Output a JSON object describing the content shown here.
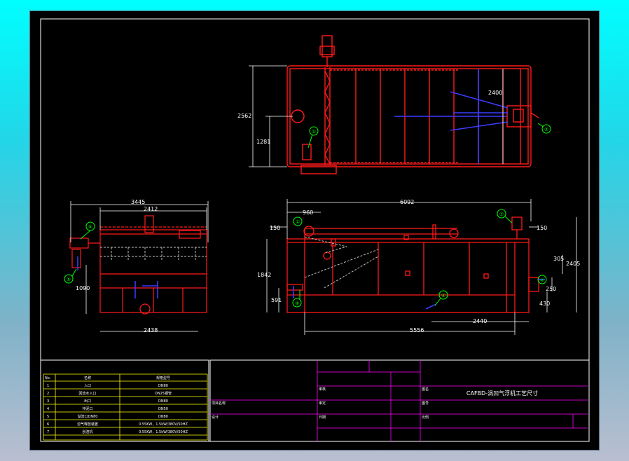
{
  "colors": {
    "background": "#000000",
    "frame": "#ffffff",
    "equipment": "#ff1a1a",
    "dimension": "#ffffff",
    "callout": "#00ff00",
    "pipe": "#3b3bff",
    "table_line": "#ffff00",
    "title_line": "#ff00ff",
    "screen_top": "#00ffff"
  },
  "plan_view": {
    "dims": {
      "length": "2562",
      "half": "1281",
      "inner": "2400"
    },
    "callouts": [
      "①",
      "②"
    ]
  },
  "side_view": {
    "dims": {
      "overall": "3445",
      "body": "2412",
      "base": "2438",
      "height": "1090"
    },
    "callouts": [
      "⑥",
      "⑤"
    ]
  },
  "front_view": {
    "dims": {
      "length": "6092",
      "inlet": "960",
      "left_offset": "150",
      "right_offset": "150",
      "height": "2405",
      "level": "1842",
      "outlet": "591",
      "d305": "305",
      "d250": "250",
      "d430": "430",
      "d2440": "2440",
      "base": "5556"
    },
    "callouts": [
      "①",
      "④",
      "③",
      "②",
      "⑦"
    ]
  },
  "parts_table": {
    "headers": [
      "No.",
      "名称",
      "规格型号"
    ],
    "rows": [
      [
        "1",
        "入口",
        "DN80"
      ],
      [
        "2",
        "回流水入口",
        "DN25钢管"
      ],
      [
        "3",
        "出口",
        "DN80"
      ],
      [
        "4",
        "排泥口",
        "DN50"
      ],
      [
        "5",
        "溢流口DN80",
        "DN80"
      ],
      [
        "6",
        "溶气释放装置",
        "0.55KW，1.5kW/380V/50HZ"
      ],
      [
        "7",
        "刮渣机",
        "0.55KW，1.5kW/380V/50HZ"
      ]
    ]
  },
  "title_block": {
    "drawing_title": "CAFBD-涡凹气浮机工艺尺寸",
    "labels": {
      "project": "项目名称",
      "design": "设计",
      "check": "审核",
      "approve": "审定",
      "date": "日期",
      "name": "图名",
      "number": "图号",
      "ratio": "比例"
    }
  }
}
